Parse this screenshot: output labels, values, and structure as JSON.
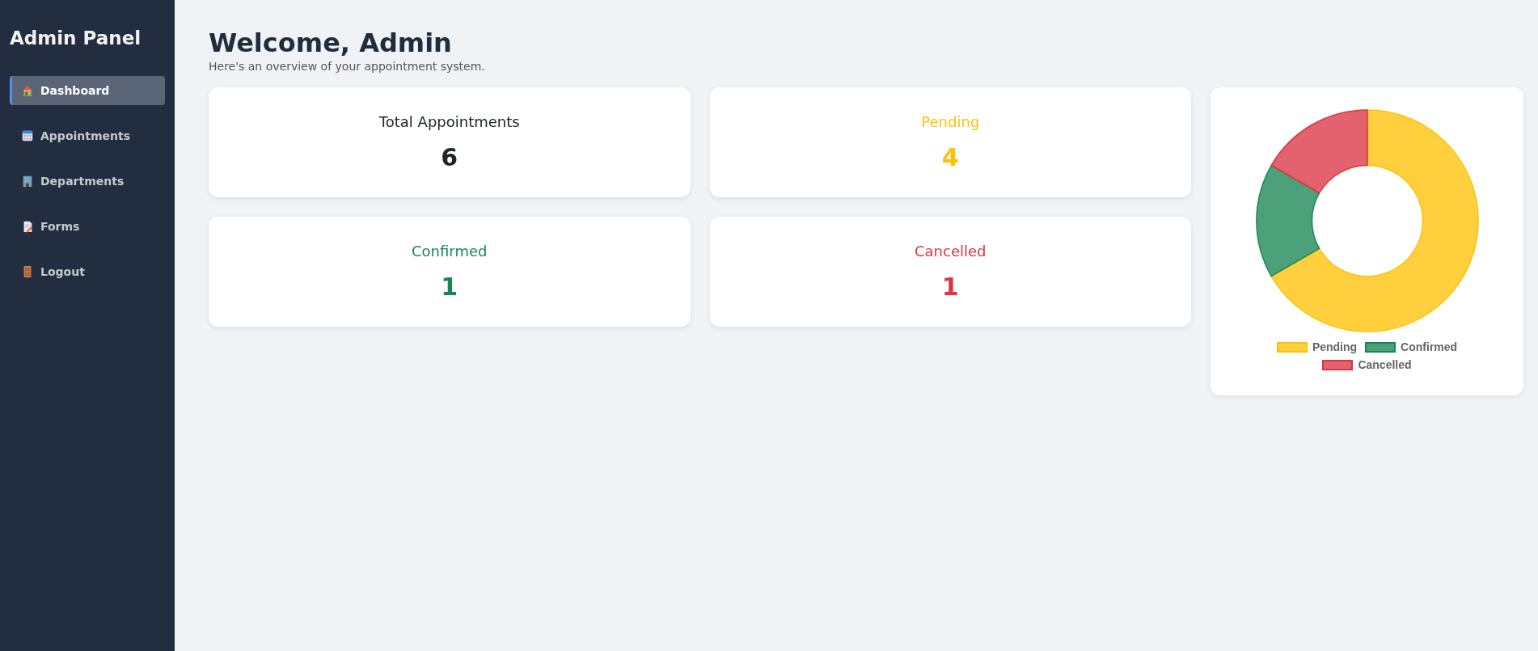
{
  "sidebar": {
    "title": "Admin Panel",
    "items": [
      {
        "label": "Dashboard",
        "selected": true
      },
      {
        "label": "Appointments",
        "selected": false
      },
      {
        "label": "Departments",
        "selected": false
      },
      {
        "label": "Forms",
        "selected": false
      },
      {
        "label": "Logout",
        "selected": false
      }
    ]
  },
  "header": {
    "title": "Welcome, Admin",
    "subtitle": "Here's an overview of your appointment system."
  },
  "stats": [
    {
      "label": "Total Appointments",
      "value": "6",
      "color": "#212529"
    },
    {
      "label": "Pending",
      "value": "4",
      "color": "#ffc107"
    },
    {
      "label": "Confirmed",
      "value": "1",
      "color": "#198754"
    },
    {
      "label": "Cancelled",
      "value": "1",
      "color": "#dc3545"
    }
  ],
  "chart": {
    "chart_data": {
      "type": "donut",
      "categories": [
        "Pending",
        "Confirmed",
        "Cancelled"
      ],
      "values": [
        66.67,
        16.67,
        16.66
      ],
      "legend": true,
      "colors": [
        "#ffc107",
        "#198754",
        "#dc3545"
      ]
    }
  }
}
